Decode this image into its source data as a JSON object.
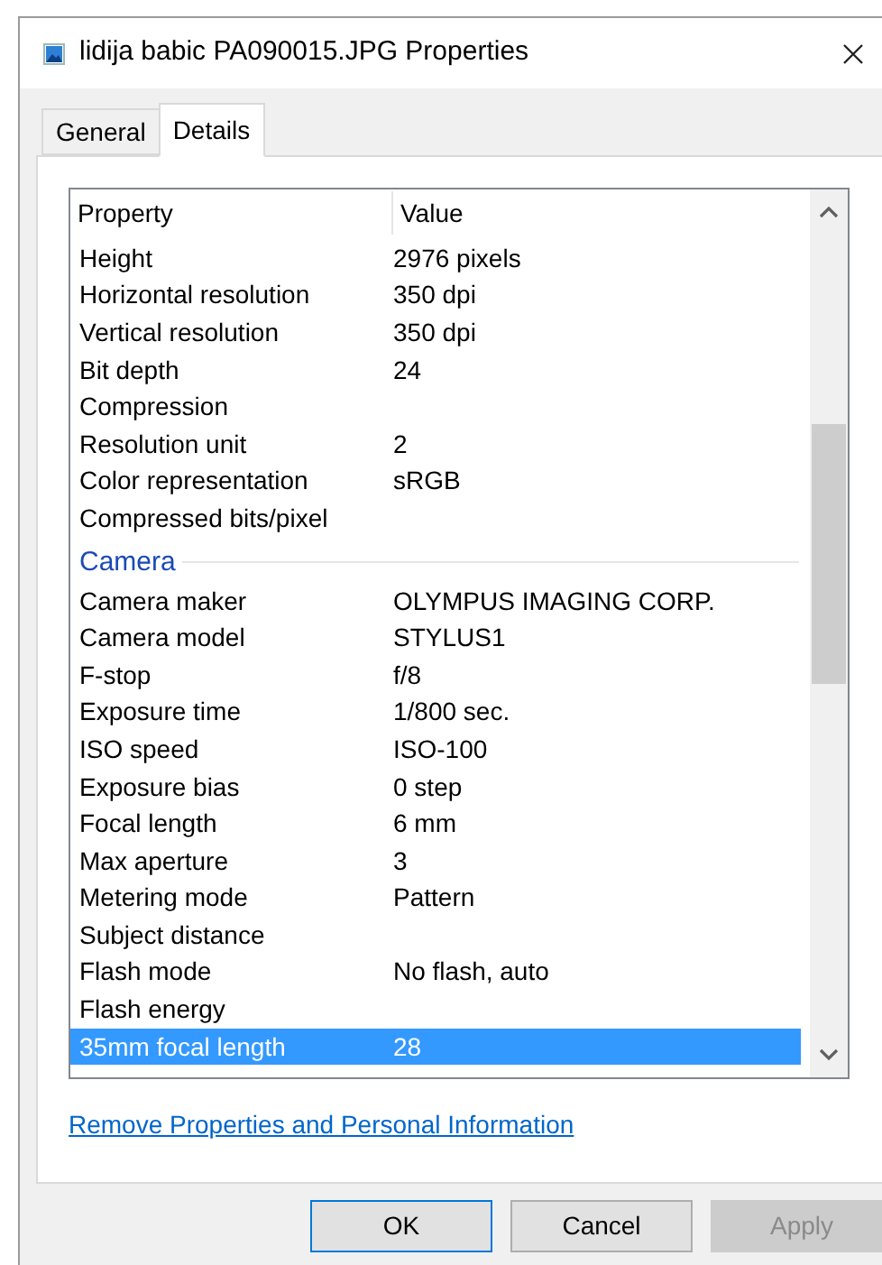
{
  "window": {
    "title": "lidija babic PA090015.JPG Properties"
  },
  "tabs": [
    {
      "label": "General",
      "selected": false
    },
    {
      "label": "Details",
      "selected": true
    }
  ],
  "table": {
    "columns": [
      "Property",
      "Value"
    ],
    "rows": [
      {
        "kind": "row",
        "property": "Height",
        "value": "2976 pixels",
        "selected": false
      },
      {
        "kind": "row",
        "property": "Horizontal resolution",
        "value": "350 dpi",
        "selected": false
      },
      {
        "kind": "row",
        "property": "Vertical resolution",
        "value": "350 dpi",
        "selected": false
      },
      {
        "kind": "row",
        "property": "Bit depth",
        "value": "24",
        "selected": false
      },
      {
        "kind": "row",
        "property": "Compression",
        "selected": false
      },
      {
        "kind": "row",
        "property": "Resolution unit",
        "value": "2",
        "selected": false
      },
      {
        "kind": "row",
        "property": "Color representation",
        "value": "sRGB",
        "selected": false
      },
      {
        "kind": "row",
        "property": "Compressed bits/pixel",
        "selected": false
      },
      {
        "kind": "group",
        "label": "Camera"
      },
      {
        "kind": "row",
        "property": "Camera maker",
        "value": "OLYMPUS IMAGING CORP.",
        "selected": false
      },
      {
        "kind": "row",
        "property": "Camera model",
        "value": "STYLUS1",
        "selected": false
      },
      {
        "kind": "row",
        "property": "F-stop",
        "value": "f/8",
        "selected": false
      },
      {
        "kind": "row",
        "property": "Exposure time",
        "value": "1/800 sec.",
        "selected": false
      },
      {
        "kind": "row",
        "property": "ISO speed",
        "value": "ISO-100",
        "selected": false
      },
      {
        "kind": "row",
        "property": "Exposure bias",
        "value": "0 step",
        "selected": false
      },
      {
        "kind": "row",
        "property": "Focal length",
        "value": "6 mm",
        "selected": false
      },
      {
        "kind": "row",
        "property": "Max aperture",
        "value": "3",
        "selected": false
      },
      {
        "kind": "row",
        "property": "Metering mode",
        "value": "Pattern",
        "selected": false
      },
      {
        "kind": "row",
        "property": "Subject distance",
        "selected": false
      },
      {
        "kind": "row",
        "property": "Flash mode",
        "value": "No flash, auto",
        "selected": false
      },
      {
        "kind": "row",
        "property": "Flash energy",
        "selected": false
      },
      {
        "kind": "row",
        "property": "35mm focal length",
        "value": "28",
        "selected": true
      }
    ]
  },
  "link": "Remove Properties and Personal Information",
  "buttons": [
    {
      "label": "OK",
      "kind": "default",
      "disabled": false
    },
    {
      "label": "Cancel",
      "kind": "normal",
      "disabled": false
    },
    {
      "label": "Apply",
      "kind": "normal",
      "disabled": true
    }
  ]
}
